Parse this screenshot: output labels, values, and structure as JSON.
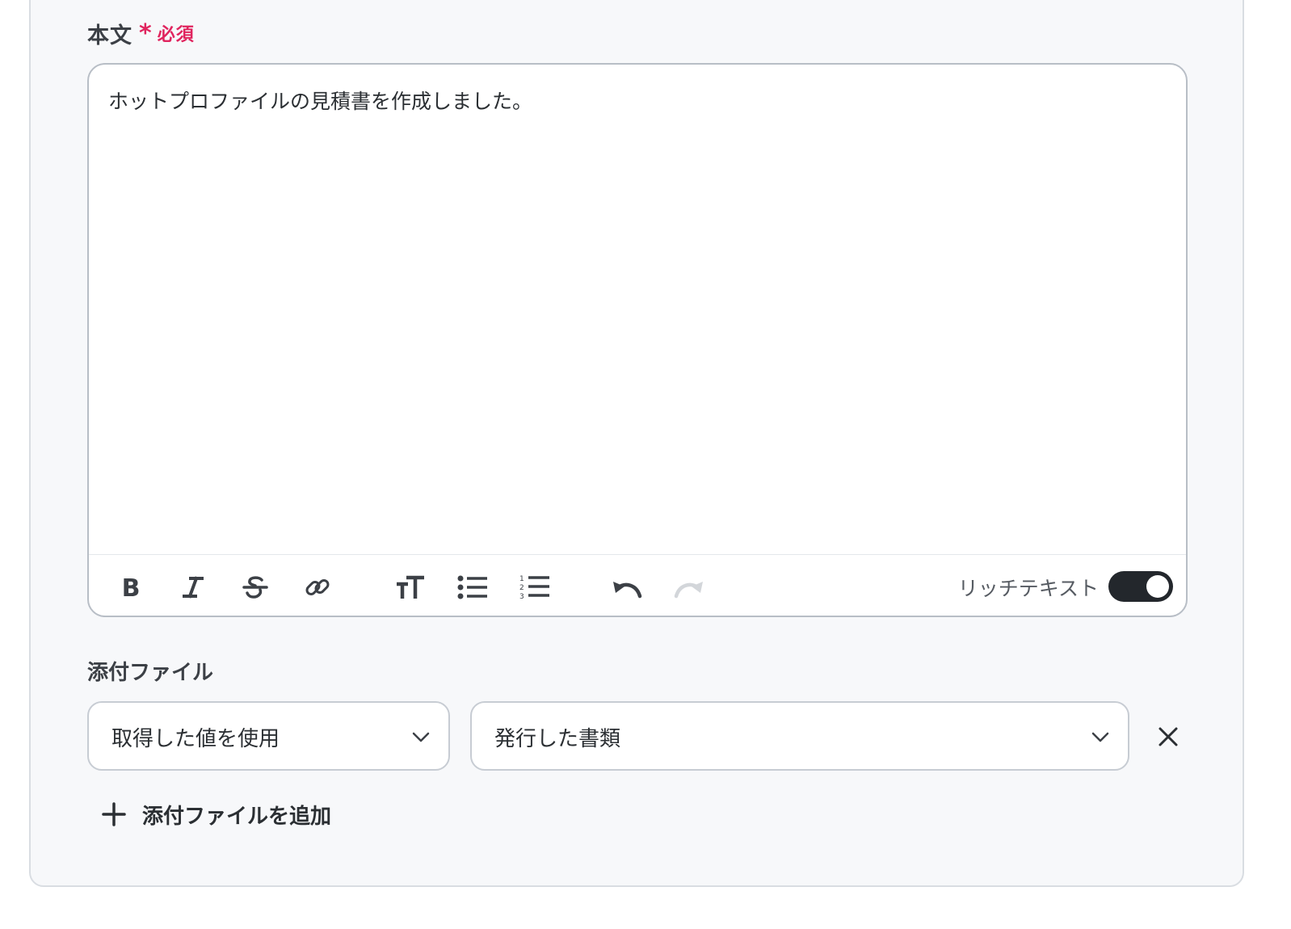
{
  "body_field": {
    "label": "本文",
    "required_mark": "*",
    "required_text": "必須",
    "content": "ホットプロファイルの見積書を作成しました。"
  },
  "toolbar": {
    "buttons": [
      {
        "name": "bold",
        "icon": "bold-icon"
      },
      {
        "name": "italic",
        "icon": "italic-icon"
      },
      {
        "name": "strikethrough",
        "icon": "strikethrough-icon"
      },
      {
        "name": "link",
        "icon": "link-icon"
      },
      {
        "name": "text-size",
        "icon": "text-size-icon"
      },
      {
        "name": "bullet-list",
        "icon": "bullet-list-icon"
      },
      {
        "name": "numbered-list",
        "icon": "numbered-list-icon"
      },
      {
        "name": "undo",
        "icon": "undo-icon"
      },
      {
        "name": "redo",
        "icon": "redo-icon",
        "disabled": true
      }
    ],
    "rich_text_label": "リッチテキスト",
    "rich_text_enabled": true
  },
  "attachments": {
    "label": "添付ファイル",
    "rows": [
      {
        "source_value": "取得した値を使用",
        "file_value": "発行した書類"
      }
    ],
    "add_label": "添付ファイルを追加"
  },
  "colors": {
    "required": "#e0245e",
    "toggle_on": "#23272c",
    "icon": "#3c4046",
    "icon_disabled": "#d3d6da"
  }
}
